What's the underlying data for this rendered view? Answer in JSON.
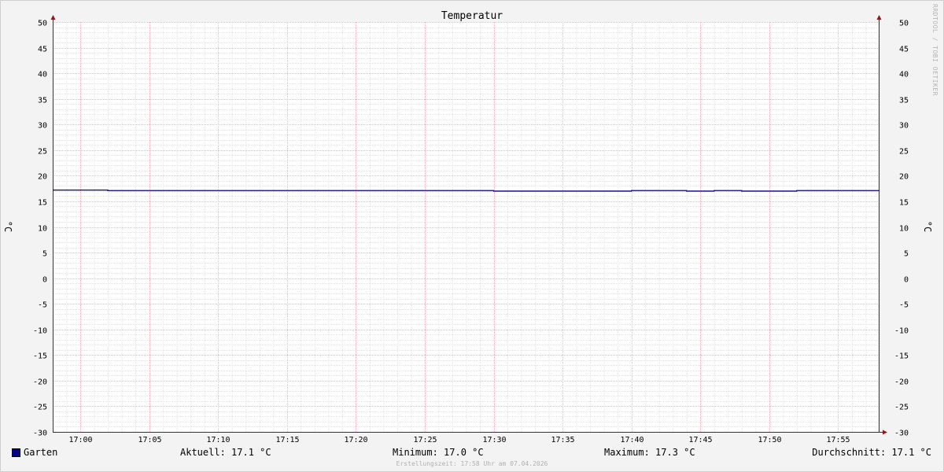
{
  "chart_data": {
    "type": "line",
    "title": "Temperatur",
    "ylabel": "°C",
    "ylim": [
      -30,
      50
    ],
    "y_ticks": [
      "50",
      "45",
      "40",
      "35",
      "30",
      "25",
      "20",
      "15",
      "10",
      "5",
      "0",
      "-5",
      "-10",
      "-15",
      "-20",
      "-25",
      "-30"
    ],
    "x_ticks": [
      "17:00",
      "17:05",
      "17:10",
      "17:15",
      "17:20",
      "17:25",
      "17:30",
      "17:35",
      "17:40",
      "17:45",
      "17:50",
      "17:55"
    ],
    "xlim": [
      "16:58",
      "17:58"
    ],
    "grid": true,
    "series": [
      {
        "name": "Garten",
        "color": "#00008b",
        "x": [
          "16:58",
          "17:02",
          "17:30",
          "17:40",
          "17:44",
          "17:46",
          "17:48",
          "17:52",
          "17:58"
        ],
        "values": [
          17.2,
          17.1,
          17.0,
          17.1,
          17.0,
          17.1,
          17.0,
          17.1,
          17.1
        ]
      }
    ]
  },
  "legend": {
    "series_name": "Garten",
    "current": "Aktuell: 17.1 °C",
    "minimum": "Minimum: 17.0 °C",
    "maximum": "Maximum: 17.3 °C",
    "average": "Durchschnitt: 17.1 °C"
  },
  "footer": "Erstellungszeit: 17:58 Uhr am 07.04.2026",
  "watermark": "RRDTOOL / TOBI OETIKER"
}
